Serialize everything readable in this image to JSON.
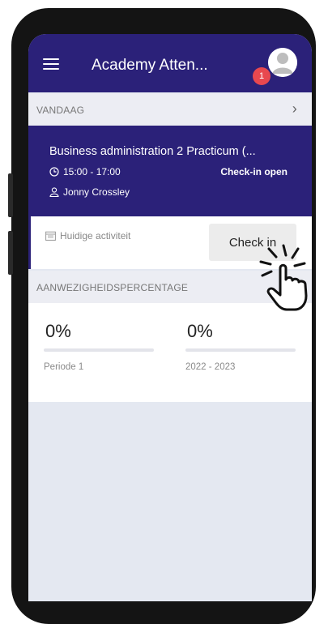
{
  "app": {
    "title": "Academy Atten...",
    "notification_count": "1"
  },
  "today": {
    "header": "VANDAAG",
    "course": "Business administration 2 Practicum (...",
    "time": "15:00 - 17:00",
    "status": "Check-in open",
    "teacher": "Jonny Crossley",
    "activity_label": "Huidige activiteit",
    "checkin_label": "Check in"
  },
  "attendance": {
    "header": "AANWEZIGHEIDSPERCENTAGE",
    "stats": [
      {
        "percent": "0%",
        "label": "Periode 1"
      },
      {
        "percent": "0%",
        "label": "2022 - 2023"
      }
    ]
  },
  "colors": {
    "primary": "#2b2179",
    "badge": "#e8484f",
    "background": "#e4e8f1"
  },
  "icons": [
    "menu-icon",
    "avatar-icon",
    "chevron-right-icon",
    "clock-icon",
    "person-icon",
    "calendar-icon",
    "pointer-hand-icon"
  ]
}
